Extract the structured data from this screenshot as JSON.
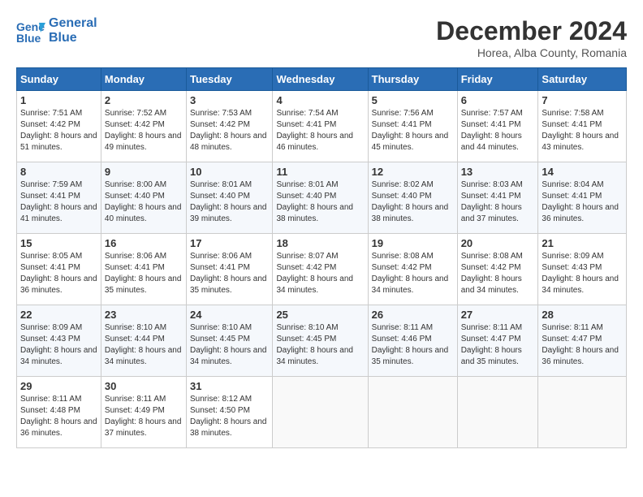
{
  "header": {
    "logo_line1": "General",
    "logo_line2": "Blue",
    "month_title": "December 2024",
    "subtitle": "Horea, Alba County, Romania"
  },
  "weekdays": [
    "Sunday",
    "Monday",
    "Tuesday",
    "Wednesday",
    "Thursday",
    "Friday",
    "Saturday"
  ],
  "weeks": [
    [
      {
        "day": "1",
        "sunrise": "7:51 AM",
        "sunset": "4:42 PM",
        "daylight": "8 hours and 51 minutes."
      },
      {
        "day": "2",
        "sunrise": "7:52 AM",
        "sunset": "4:42 PM",
        "daylight": "8 hours and 49 minutes."
      },
      {
        "day": "3",
        "sunrise": "7:53 AM",
        "sunset": "4:42 PM",
        "daylight": "8 hours and 48 minutes."
      },
      {
        "day": "4",
        "sunrise": "7:54 AM",
        "sunset": "4:41 PM",
        "daylight": "8 hours and 46 minutes."
      },
      {
        "day": "5",
        "sunrise": "7:56 AM",
        "sunset": "4:41 PM",
        "daylight": "8 hours and 45 minutes."
      },
      {
        "day": "6",
        "sunrise": "7:57 AM",
        "sunset": "4:41 PM",
        "daylight": "8 hours and 44 minutes."
      },
      {
        "day": "7",
        "sunrise": "7:58 AM",
        "sunset": "4:41 PM",
        "daylight": "8 hours and 43 minutes."
      }
    ],
    [
      {
        "day": "8",
        "sunrise": "7:59 AM",
        "sunset": "4:41 PM",
        "daylight": "8 hours and 41 minutes."
      },
      {
        "day": "9",
        "sunrise": "8:00 AM",
        "sunset": "4:40 PM",
        "daylight": "8 hours and 40 minutes."
      },
      {
        "day": "10",
        "sunrise": "8:01 AM",
        "sunset": "4:40 PM",
        "daylight": "8 hours and 39 minutes."
      },
      {
        "day": "11",
        "sunrise": "8:01 AM",
        "sunset": "4:40 PM",
        "daylight": "8 hours and 38 minutes."
      },
      {
        "day": "12",
        "sunrise": "8:02 AM",
        "sunset": "4:40 PM",
        "daylight": "8 hours and 38 minutes."
      },
      {
        "day": "13",
        "sunrise": "8:03 AM",
        "sunset": "4:41 PM",
        "daylight": "8 hours and 37 minutes."
      },
      {
        "day": "14",
        "sunrise": "8:04 AM",
        "sunset": "4:41 PM",
        "daylight": "8 hours and 36 minutes."
      }
    ],
    [
      {
        "day": "15",
        "sunrise": "8:05 AM",
        "sunset": "4:41 PM",
        "daylight": "8 hours and 36 minutes."
      },
      {
        "day": "16",
        "sunrise": "8:06 AM",
        "sunset": "4:41 PM",
        "daylight": "8 hours and 35 minutes."
      },
      {
        "day": "17",
        "sunrise": "8:06 AM",
        "sunset": "4:41 PM",
        "daylight": "8 hours and 35 minutes."
      },
      {
        "day": "18",
        "sunrise": "8:07 AM",
        "sunset": "4:42 PM",
        "daylight": "8 hours and 34 minutes."
      },
      {
        "day": "19",
        "sunrise": "8:08 AM",
        "sunset": "4:42 PM",
        "daylight": "8 hours and 34 minutes."
      },
      {
        "day": "20",
        "sunrise": "8:08 AM",
        "sunset": "4:42 PM",
        "daylight": "8 hours and 34 minutes."
      },
      {
        "day": "21",
        "sunrise": "8:09 AM",
        "sunset": "4:43 PM",
        "daylight": "8 hours and 34 minutes."
      }
    ],
    [
      {
        "day": "22",
        "sunrise": "8:09 AM",
        "sunset": "4:43 PM",
        "daylight": "8 hours and 34 minutes."
      },
      {
        "day": "23",
        "sunrise": "8:10 AM",
        "sunset": "4:44 PM",
        "daylight": "8 hours and 34 minutes."
      },
      {
        "day": "24",
        "sunrise": "8:10 AM",
        "sunset": "4:45 PM",
        "daylight": "8 hours and 34 minutes."
      },
      {
        "day": "25",
        "sunrise": "8:10 AM",
        "sunset": "4:45 PM",
        "daylight": "8 hours and 34 minutes."
      },
      {
        "day": "26",
        "sunrise": "8:11 AM",
        "sunset": "4:46 PM",
        "daylight": "8 hours and 35 minutes."
      },
      {
        "day": "27",
        "sunrise": "8:11 AM",
        "sunset": "4:47 PM",
        "daylight": "8 hours and 35 minutes."
      },
      {
        "day": "28",
        "sunrise": "8:11 AM",
        "sunset": "4:47 PM",
        "daylight": "8 hours and 36 minutes."
      }
    ],
    [
      {
        "day": "29",
        "sunrise": "8:11 AM",
        "sunset": "4:48 PM",
        "daylight": "8 hours and 36 minutes."
      },
      {
        "day": "30",
        "sunrise": "8:11 AM",
        "sunset": "4:49 PM",
        "daylight": "8 hours and 37 minutes."
      },
      {
        "day": "31",
        "sunrise": "8:12 AM",
        "sunset": "4:50 PM",
        "daylight": "8 hours and 38 minutes."
      },
      null,
      null,
      null,
      null
    ]
  ]
}
